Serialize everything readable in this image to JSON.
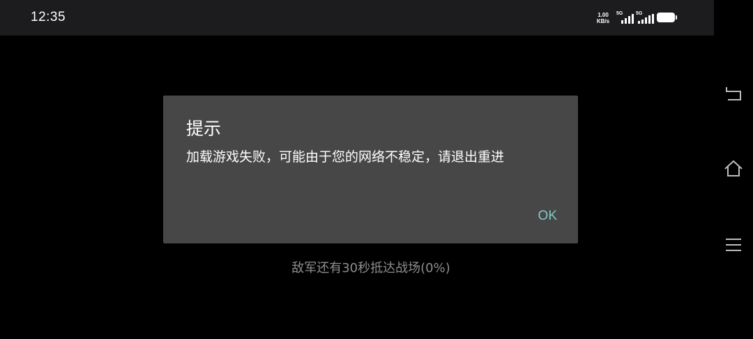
{
  "status_bar": {
    "time": "12:35",
    "net_speed_value": "1.00",
    "net_speed_unit": "KB/s",
    "signal_1": "5G",
    "signal_2": "5G"
  },
  "dialog": {
    "title": "提示",
    "message": "加载游戏失败，可能由于您的网络不稳定，请退出重进",
    "ok_label": "OK"
  },
  "loading": {
    "text": "敌军还有30秒抵达战场(0%)"
  },
  "navigation": {
    "icons": [
      "back-icon",
      "home-icon",
      "menu-icon"
    ]
  },
  "colors": {
    "dialog_bg": "#474747",
    "accent": "#80cbc4",
    "status_bar_bg": "#1c1c1e"
  }
}
